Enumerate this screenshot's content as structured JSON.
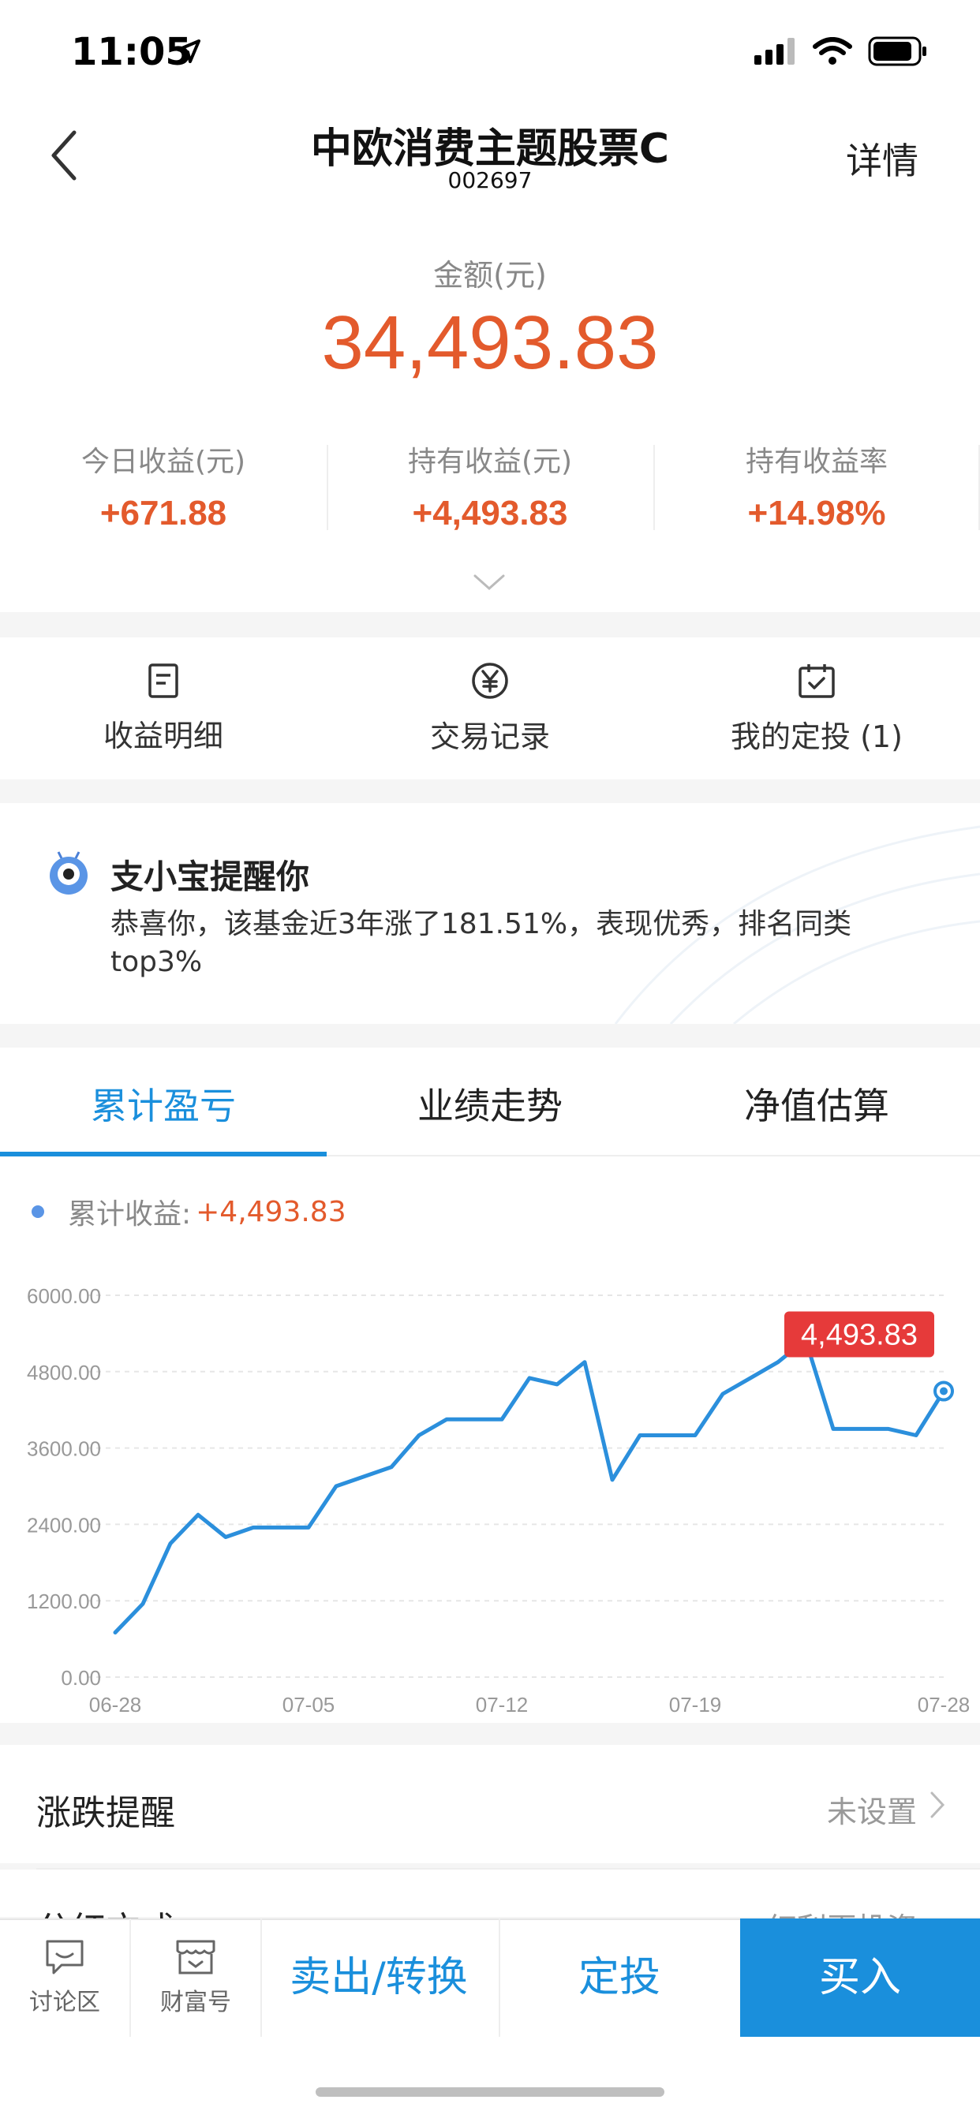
{
  "status": {
    "time": "11:05"
  },
  "header": {
    "title": "中欧消费主题股票C",
    "code": "002697",
    "details_label": "详情"
  },
  "amount": {
    "label": "金额(元)",
    "value": "34,493.83"
  },
  "stats": [
    {
      "label": "今日收益(元)",
      "value": "+671.88"
    },
    {
      "label": "持有收益(元)",
      "value": "+4,493.83"
    },
    {
      "label": "持有收益率",
      "value": "+14.98%"
    }
  ],
  "quick_actions": [
    {
      "label": "收益明细",
      "icon": "document-icon"
    },
    {
      "label": "交易记录",
      "icon": "yuan-circle-icon"
    },
    {
      "label": "我的定投 (1)",
      "icon": "calendar-check-icon"
    }
  ],
  "notice": {
    "title": "支小宝提醒你",
    "text": "恭喜你，该基金近3年涨了181.51%，表现优秀，排名同类top3%"
  },
  "tabs": [
    "累计盈亏",
    "业绩走势",
    "净值估算"
  ],
  "legend": {
    "label": "累计收益:",
    "value": "+4,493.83"
  },
  "chart_data": {
    "type": "line",
    "series": [
      {
        "name": "累计收益",
        "x": [
          "06-28",
          "06-29",
          "06-30",
          "07-01",
          "07-02",
          "07-03",
          "07-04",
          "07-05",
          "07-06",
          "07-07",
          "07-08",
          "07-09",
          "07-10",
          "07-11",
          "07-12",
          "07-13",
          "07-14",
          "07-15",
          "07-16",
          "07-17",
          "07-18",
          "07-19",
          "07-20",
          "07-21",
          "07-22",
          "07-23",
          "07-24",
          "07-25",
          "07-26",
          "07-27",
          "07-28"
        ],
        "values": [
          700,
          1150,
          2100,
          2550,
          2200,
          2350,
          2350,
          2350,
          3000,
          3150,
          3300,
          3800,
          4050,
          4050,
          4050,
          4700,
          4600,
          4950,
          3100,
          3800,
          3800,
          3800,
          4450,
          4700,
          4950,
          5300,
          3900,
          3900,
          3900,
          3800,
          4493.83
        ]
      }
    ],
    "y_ticks": [
      "0.00",
      "1200.00",
      "2400.00",
      "3600.00",
      "4800.00",
      "6000.00"
    ],
    "x_ticks": [
      "06-28",
      "07-05",
      "07-12",
      "07-19",
      "07-28"
    ],
    "ylim": [
      0,
      6000
    ],
    "grid": true,
    "last_value_label": "4,493.83",
    "color": "#2b8fdc"
  },
  "settings": [
    {
      "label": "涨跌提醒",
      "value": "未设置"
    },
    {
      "label": "分红方式",
      "value": "红利再投资"
    }
  ],
  "bottom_bar": {
    "discuss": "讨论区",
    "wealth": "财富号",
    "sell": "卖出/转换",
    "plan": "定投",
    "buy": "买入"
  },
  "colors": {
    "accent": "#1a8fdc",
    "gain": "#e35a2c"
  }
}
